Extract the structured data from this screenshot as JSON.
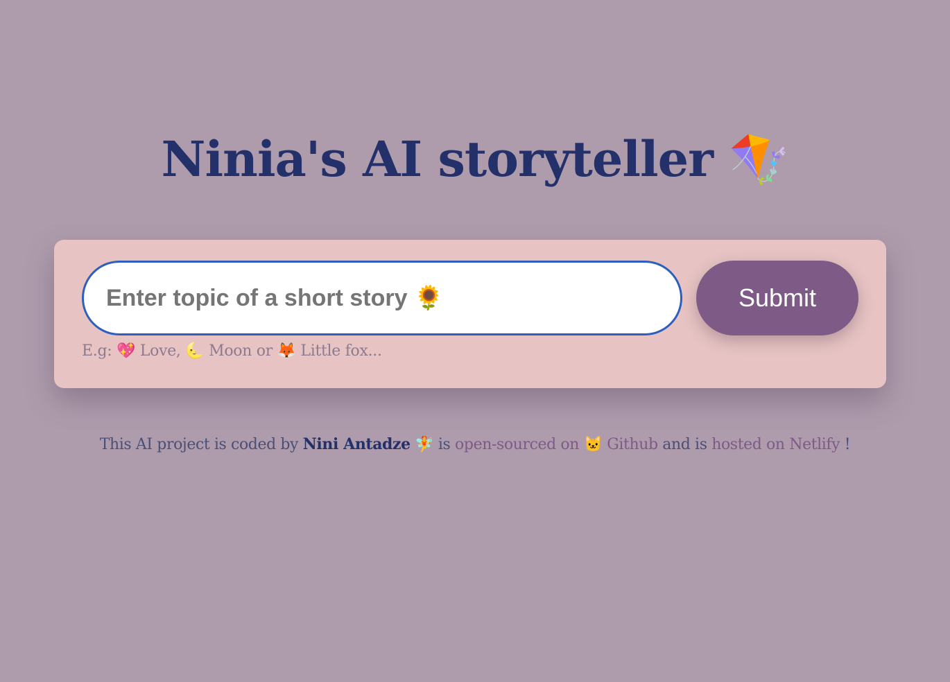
{
  "header": {
    "title": "Ninia's AI storyteller",
    "title_emoji": "🪁"
  },
  "form": {
    "input_placeholder": "Enter topic of a short story 🌻",
    "input_value": "",
    "submit_label": "Submit",
    "hint_text": "E.g: 💖 Love, 🌜 Moon or 🦊 Little fox..."
  },
  "footer": {
    "prefix": "This AI project is coded by",
    "author": "Nini Antadze",
    "author_emoji": "🧚",
    "is": "is",
    "github_link": "open-sourced on 🐱 Github",
    "and_is": "and is",
    "netlify_link": "hosted on Netlify",
    "suffix": "!"
  },
  "colors": {
    "background": "#ae9cad",
    "card": "#e7c4c3",
    "title": "#24306a",
    "accent": "#7e5a87",
    "input_border": "#2f5fbd"
  }
}
